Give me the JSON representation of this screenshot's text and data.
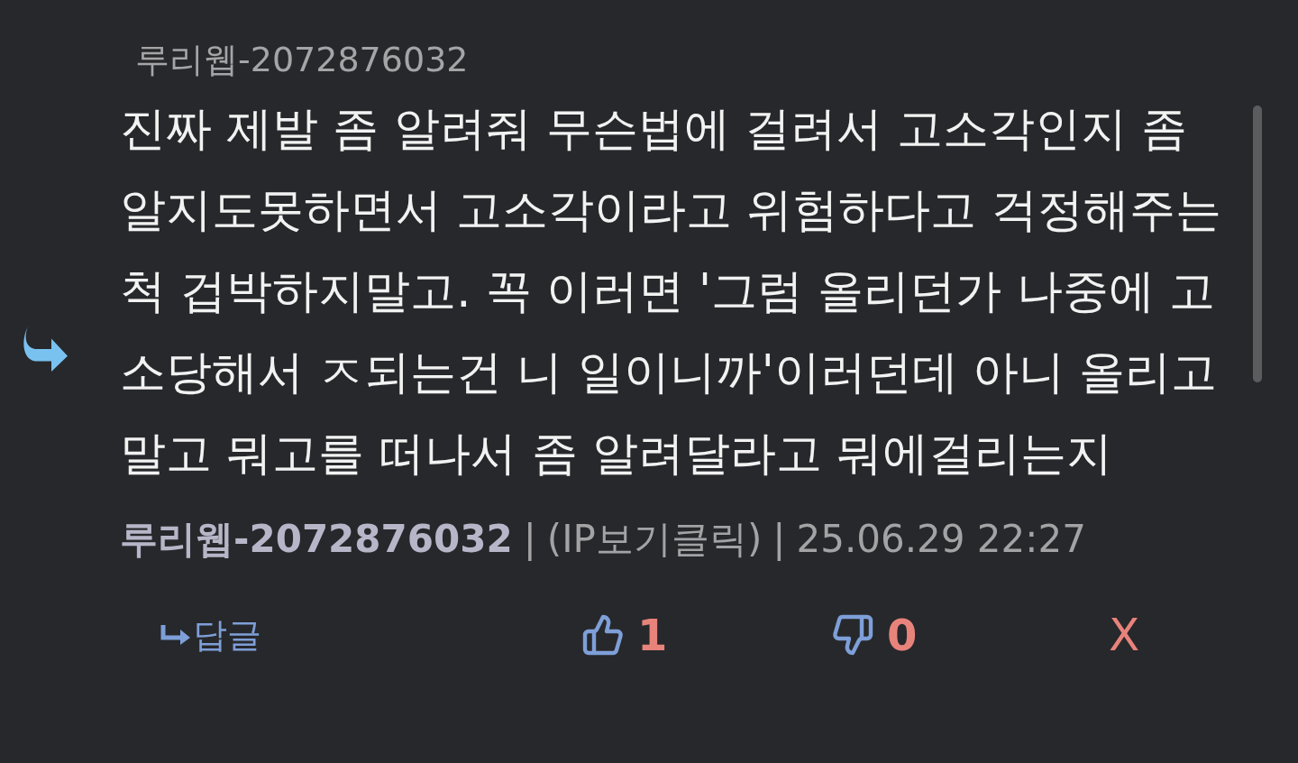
{
  "comment": {
    "header_author": "루리웹-2072876032",
    "body": "진짜 제발 좀 알려줘 무슨법에 걸려서 고소각인지 좀 알지도못하면서 고소각이라고 위험하다고 걱정해주는척 겁박하지말고. 꼭 이러면 '그럼 올리던가 나중에 고소당해서 ㅈ되는건 니 일이니까'이러던데 아니 올리고 말고 뭐고를 떠나서 좀 알려달라고 뭐에걸리는지",
    "meta": [
      {
        "kind": "author",
        "text": "루리웹-2072876032"
      },
      {
        "kind": "separator",
        "text": "|"
      },
      {
        "kind": "link",
        "text": "(IP보기클릭)"
      },
      {
        "kind": "separator",
        "text": "|"
      },
      {
        "kind": "date",
        "text": "25.06.29 22:27"
      }
    ],
    "actions": {
      "reply": "답글",
      "likes": "1",
      "dislikes": "0",
      "delete": "X"
    }
  }
}
